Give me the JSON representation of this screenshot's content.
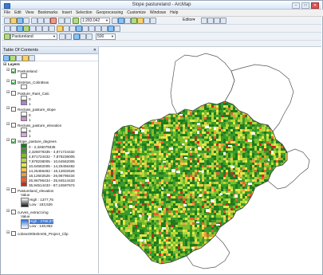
{
  "window": {
    "title": "Slope pastureland - ArcMap"
  },
  "menu": [
    "File",
    "Edit",
    "View",
    "Bookmarks",
    "Insert",
    "Selection",
    "Geoprocessing",
    "Customize",
    "Windows",
    "Help"
  ],
  "toolbar": {
    "scale": "1:283.042",
    "editor_label": "Editor▾",
    "layer_select": "Pastureland",
    "zoom_value": "500"
  },
  "toc": {
    "title": "Table Of Contents",
    "root": "Layers",
    "layers": [
      {
        "name": "Pastureland",
        "checked": true
      },
      {
        "name": "Distritos_ColinBras",
        "checked": true
      },
      {
        "name": "Pasture_Raet_Calc",
        "checked": false,
        "values": [
          "0",
          "1"
        ]
      },
      {
        "name": "Reclass_pasture_slope",
        "checked": false,
        "values": [
          "0",
          "1"
        ]
      },
      {
        "name": "Reclass_pasture_elevation",
        "checked": false,
        "values": [
          "0",
          "1"
        ]
      },
      {
        "name": "Slope_pasture_degrees",
        "checked": true,
        "classes": [
          {
            "label": "0 - 2,326079335",
            "color": "#1f7a1f"
          },
          {
            "label": "2,326079335 - 4,871724432",
            "color": "#3a9a2a"
          },
          {
            "label": "4,871724432 - 7,878238005",
            "color": "#7dbd2e"
          },
          {
            "label": "7,878238005 - 10,64562005",
            "color": "#b6d83a"
          },
          {
            "label": "10,64562005 - 14,25456482",
            "color": "#e3e84a"
          },
          {
            "label": "14,25456482 - 18,12602526",
            "color": "#f2c84a"
          },
          {
            "label": "18,12602526 - 26,96796434",
            "color": "#f09a3a"
          },
          {
            "label": "26,96796434 - 35,94514433",
            "color": "#e8622e"
          },
          {
            "label": "35,94514433 - 87,24597674",
            "color": "#c92a1e"
          }
        ]
      },
      {
        "name": "Pastureland_elevation",
        "checked": false,
        "value_label": "Value",
        "high": "High : 1377,75",
        "low": "Low : 163,526"
      },
      {
        "name": "curves_extract.img",
        "checked": false,
        "value_label": "Value",
        "high": "High : 3788,97",
        "low": "Low : 148,952"
      },
      {
        "name": "cobse2005shm05_Project_Clip",
        "checked": false
      }
    ]
  },
  "colors": {
    "boundary": "#5a5a5a",
    "map_bg": "#ffffff"
  }
}
